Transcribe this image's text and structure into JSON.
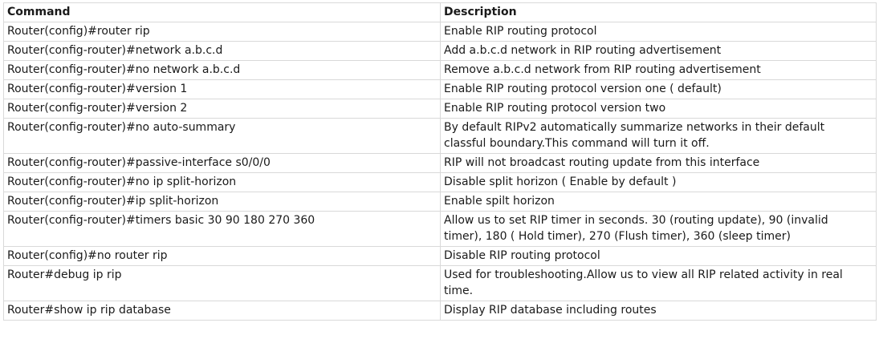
{
  "table": {
    "headers": {
      "command": "Command",
      "description": "Description"
    },
    "rows": [
      {
        "command": "Router(config)#router rip",
        "description": "Enable RIP routing protocol"
      },
      {
        "command": "Router(config-router)#network a.b.c.d",
        "description": "Add a.b.c.d network in RIP routing advertisement"
      },
      {
        "command": "Router(config-router)#no network a.b.c.d",
        "description": "Remove a.b.c.d network from RIP routing advertisement"
      },
      {
        "command": "Router(config-router)#version 1",
        "description": "Enable RIP routing protocol version one ( default)"
      },
      {
        "command": "Router(config-router)#version 2",
        "description": "Enable RIP routing protocol version two"
      },
      {
        "command": "Router(config-router)#no auto-summary",
        "description": "By default RIPv2 automatically summarize networks in their default classful boundary.This command will turn it off."
      },
      {
        "command": "Router(config-router)#passive-interface s0/0/0",
        "description": "RIP will not broadcast routing update from this interface"
      },
      {
        "command": "Router(config-router)#no ip split-horizon",
        "description": "Disable split horizon ( Enable by default )"
      },
      {
        "command": "Router(config-router)#ip split-horizon",
        "description": "Enable spilt horizon"
      },
      {
        "command": "Router(config-router)#timers basic 30 90 180 270 360",
        "description": "Allow us to set RIP timer in seconds. 30 (routing update), 90 (invalid timer), 180 ( Hold timer), 270 (Flush timer), 360 (sleep timer)"
      },
      {
        "command": "Router(config)#no router rip",
        "description": "Disable RIP routing protocol"
      },
      {
        "command": "Router#debug ip rip",
        "description": "Used for troubleshooting.Allow us to view all RIP related activity in real time."
      },
      {
        "command": "Router#show ip rip database",
        "description": "Display RIP database including routes"
      }
    ]
  }
}
